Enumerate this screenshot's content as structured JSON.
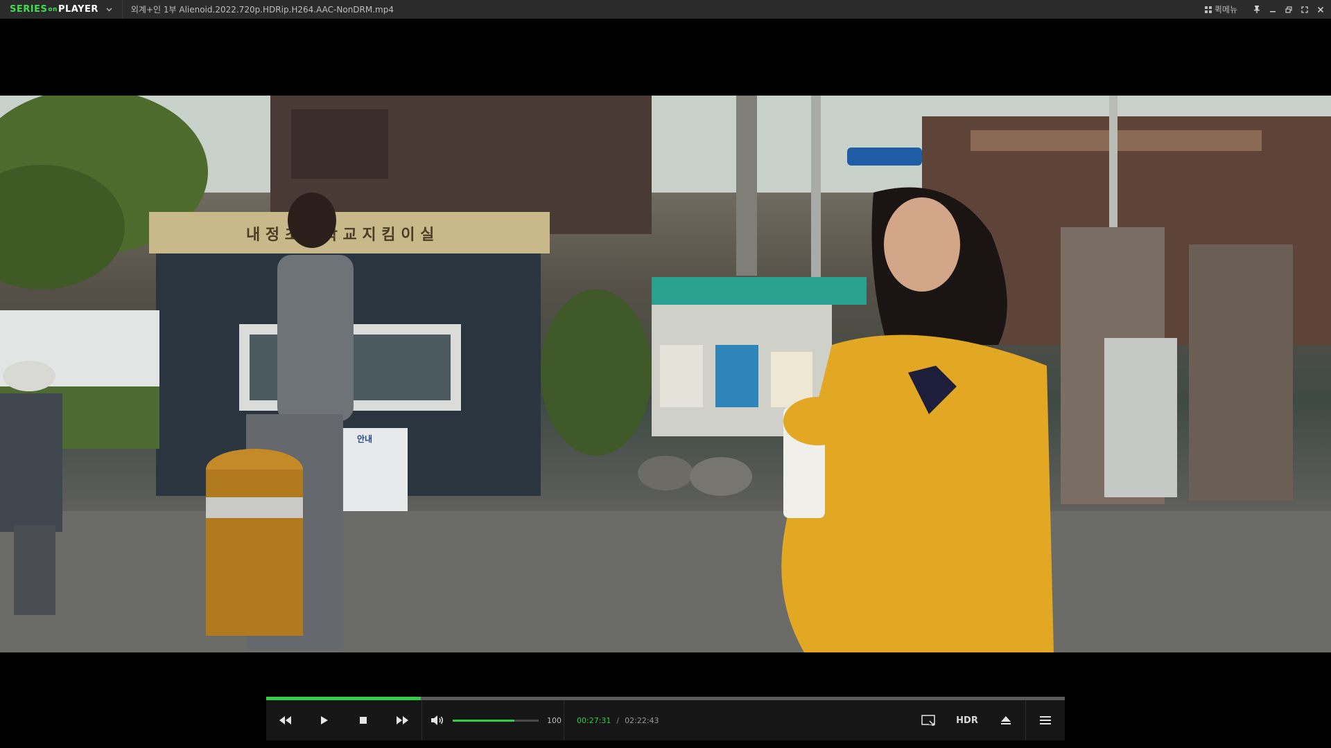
{
  "app": {
    "logo": {
      "part1": "SERIES",
      "part2": "on",
      "part3": "PLAYER"
    },
    "file_title": "외계+인  1부 Alienoid.2022.720p.HDRip.H264.AAC-NonDRM.mp4",
    "quick_menu_label": "퀵메뉴"
  },
  "player": {
    "progress": 0.194,
    "volume": 100,
    "volume_level": 0.72,
    "current_time": "00:27:31",
    "total_time": "02:22:43",
    "hdr_label": "HDR"
  },
  "video": {
    "signs": {
      "booth_sign": "내 정 초 등 학 교  지 킴 이 실",
      "notice_title": "안내"
    }
  },
  "colors": {
    "accent": "#2fcf4a",
    "titlebar": "#2b2b2b",
    "controlbar": "#161616"
  }
}
